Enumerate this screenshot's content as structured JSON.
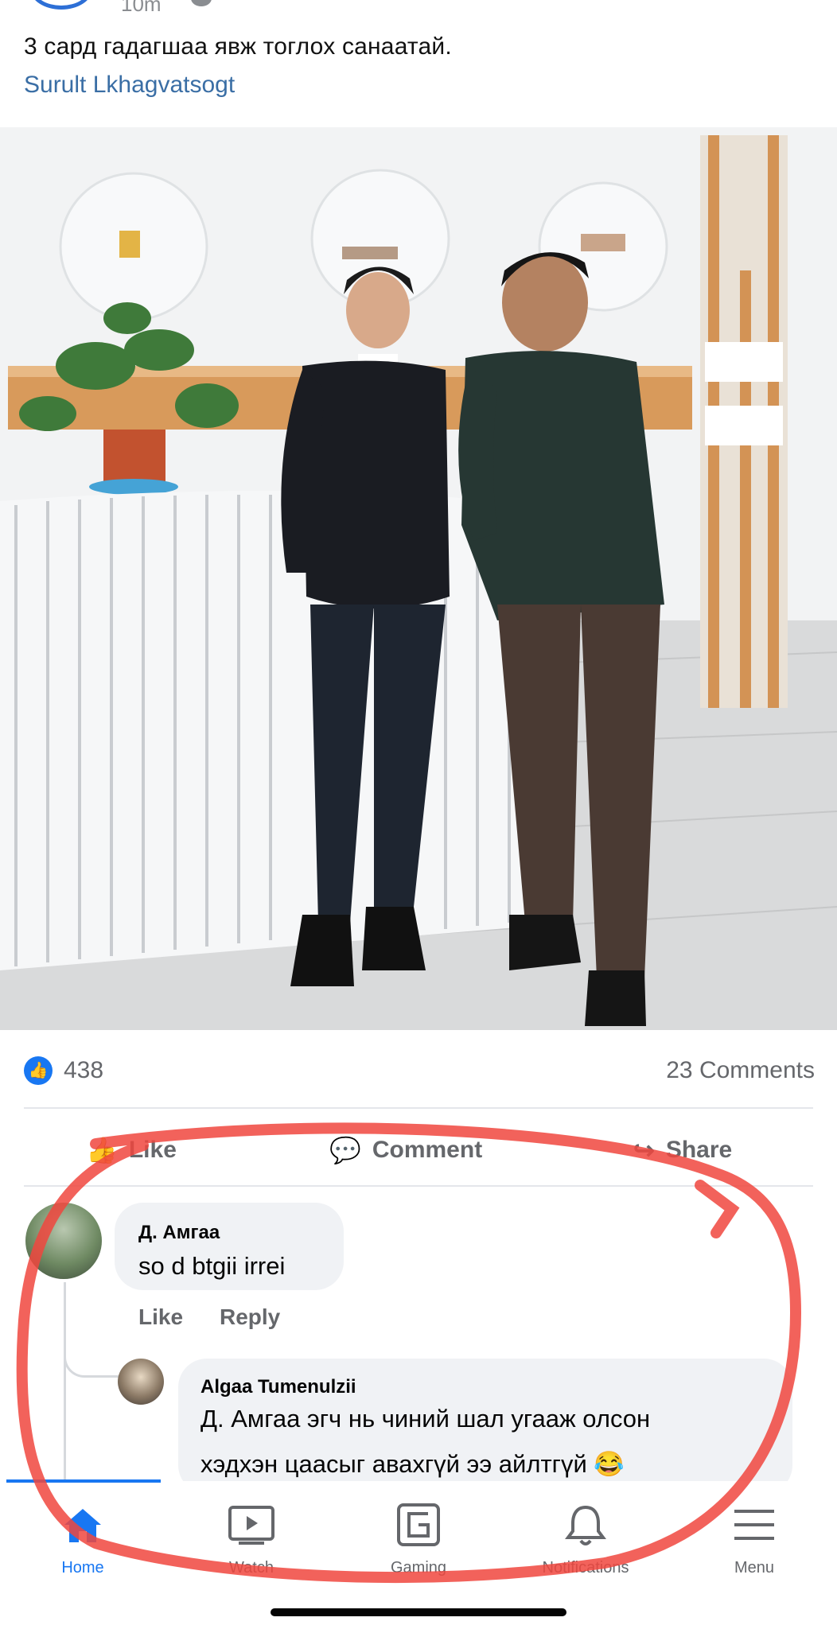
{
  "header": {
    "time": "10m"
  },
  "post": {
    "text": "3 сард гадагшаа явж тоглох санаатай.",
    "tagged": "Surult Lkhagvatsogt"
  },
  "reactions": {
    "likes": "438",
    "comments": "23 Comments"
  },
  "actions": {
    "like": "Like",
    "comment": "Comment",
    "share": "Share"
  },
  "comments": [
    {
      "author": "Д. Амгаа",
      "text": "so d btgii irrei",
      "like_label": "Like",
      "reply_label": "Reply"
    },
    {
      "author": "Algaa Tumenulzii",
      "text_line1": "Д. Амгаа  эгч нь чиний шал угааж олсон",
      "text_line2": "хэдхэн цаасыг авахгүй ээ айлтгүй 😂"
    }
  ],
  "nav": {
    "items": [
      {
        "label": "Home",
        "icon": "home-icon",
        "active": true
      },
      {
        "label": "Watch",
        "icon": "watch-icon"
      },
      {
        "label": "Gaming",
        "icon": "gaming-icon"
      },
      {
        "label": "Notifications",
        "icon": "bell-icon"
      },
      {
        "label": "Menu",
        "icon": "menu-icon"
      }
    ]
  },
  "colors": {
    "brand_blue": "#1877f2",
    "link_blue": "#3a6ea5",
    "annotation_red": "#f0473e"
  }
}
